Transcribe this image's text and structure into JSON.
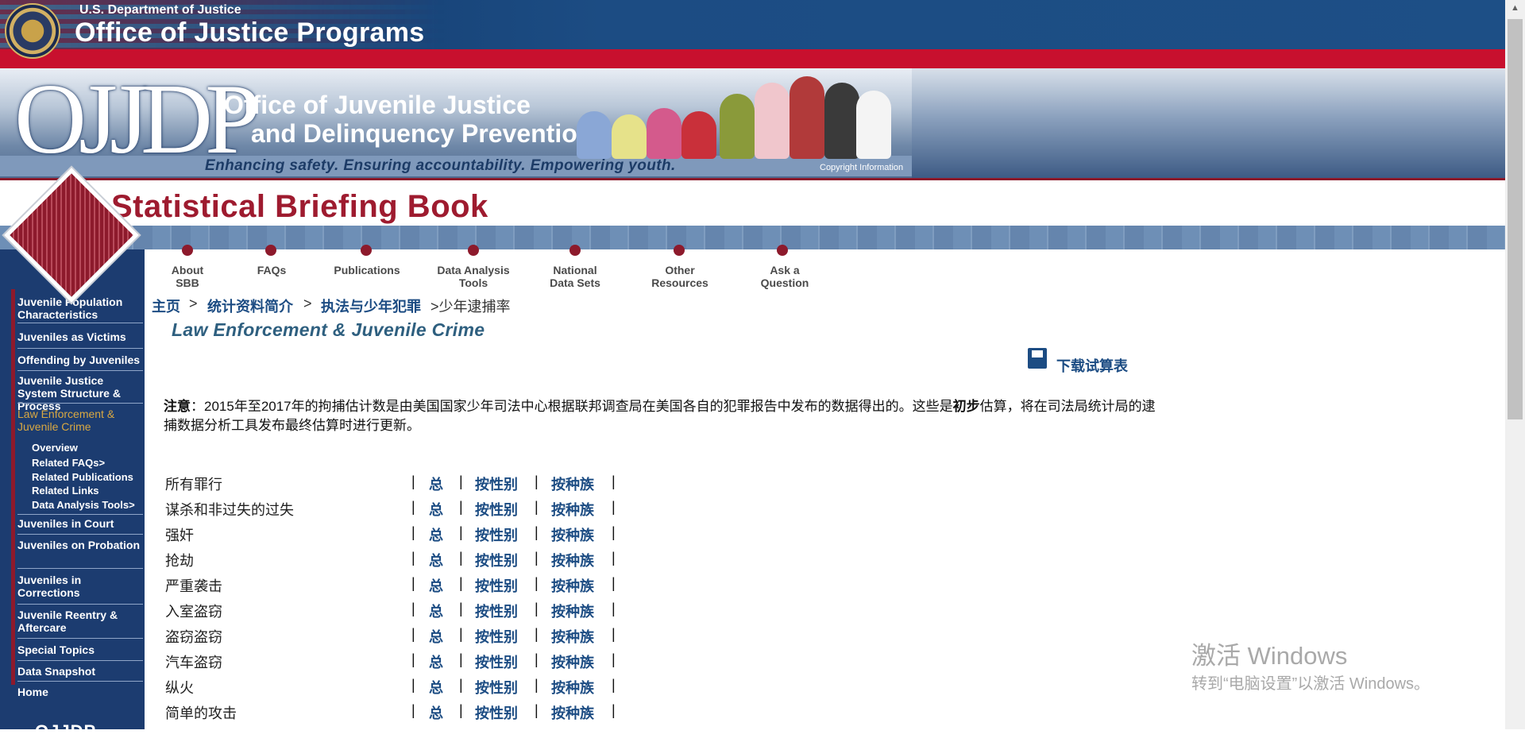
{
  "doj": {
    "subtitle": "U.S. Department of Justice",
    "title": "Office of Justice Programs"
  },
  "ojjdp": {
    "logo": "OJJDP",
    "name_line1": "Office of Juvenile Justice",
    "name_line2": "and Delinquency Prevention",
    "tagline": "Enhancing safety. Ensuring accountability. Empowering youth.",
    "copyright": "Copyright Information"
  },
  "sbb": {
    "title": "Statistical Briefing Book"
  },
  "nav": [
    {
      "line1": "About",
      "line2": "SBB"
    },
    {
      "line1": "FAQs",
      "line2": ""
    },
    {
      "line1": "Publications",
      "line2": ""
    },
    {
      "line1": "Data Analysis",
      "line2": "Tools"
    },
    {
      "line1": "National",
      "line2": "Data Sets"
    },
    {
      "line1": "Other",
      "line2": "Resources"
    },
    {
      "line1": "Ask a",
      "line2": "Question"
    }
  ],
  "sidebar": {
    "items": [
      {
        "label": "Juvenile Population Characteristics"
      },
      {
        "label": "Juveniles as Victims"
      },
      {
        "label": "Offending by Juveniles"
      },
      {
        "label": "Juvenile Justice System Structure & Process"
      },
      {
        "label": "Law Enforcement & Juvenile Crime"
      },
      {
        "label": "Juveniles in Court"
      },
      {
        "label": "Juveniles on Probation"
      },
      {
        "label": "Juveniles in Corrections"
      },
      {
        "label": "Juvenile Reentry & Aftercare"
      },
      {
        "label": "Special Topics"
      },
      {
        "label": "Data Snapshot"
      },
      {
        "label": "Home"
      }
    ],
    "subitems": [
      {
        "label": "Overview"
      },
      {
        "label": "Related FAQs>"
      },
      {
        "label": "Related Publications"
      },
      {
        "label": "Related Links"
      },
      {
        "label": "Data Analysis Tools>"
      }
    ],
    "bottom_logo": "OJJDP"
  },
  "breadcrumb": {
    "home": "主页",
    "sep": ">",
    "level1": "统计资料简介",
    "level2": "执法与少年犯罪",
    "current": ">少年逮捕率"
  },
  "section_title": "Law Enforcement & Juvenile Crime",
  "download_label": "下载试算表",
  "note": {
    "label": "注意",
    "text_a": "：2015年至2017年的拘捕估计数是由美国国家少年司法中心根据联邦调查局在美国各自的犯罪报告中发布的数据得出的。这些是",
    "bold": "初步",
    "text_b": "估算，将在司法局统计局的逮捕数据分析工具发布最终估算时进行更新。"
  },
  "table": {
    "pipe": "|",
    "link_total": "总",
    "link_sex": "按性别",
    "link_race": "按种族",
    "rows": [
      "所有罪行",
      "谋杀和非过失的过失",
      "强奸",
      "抢劫",
      "严重袭击",
      "入室盗窃",
      "盗窃盗窃",
      "汽车盗窃",
      "纵火",
      "简单的攻击"
    ]
  },
  "watermark": {
    "line1": "激活 Windows",
    "line2": "转到“电脑设置”以激活 Windows。"
  },
  "colors": {
    "navy": "#1c3c70",
    "maroon": "#8d1a2c",
    "link": "#1c4c83",
    "gold": "#d9a842"
  }
}
